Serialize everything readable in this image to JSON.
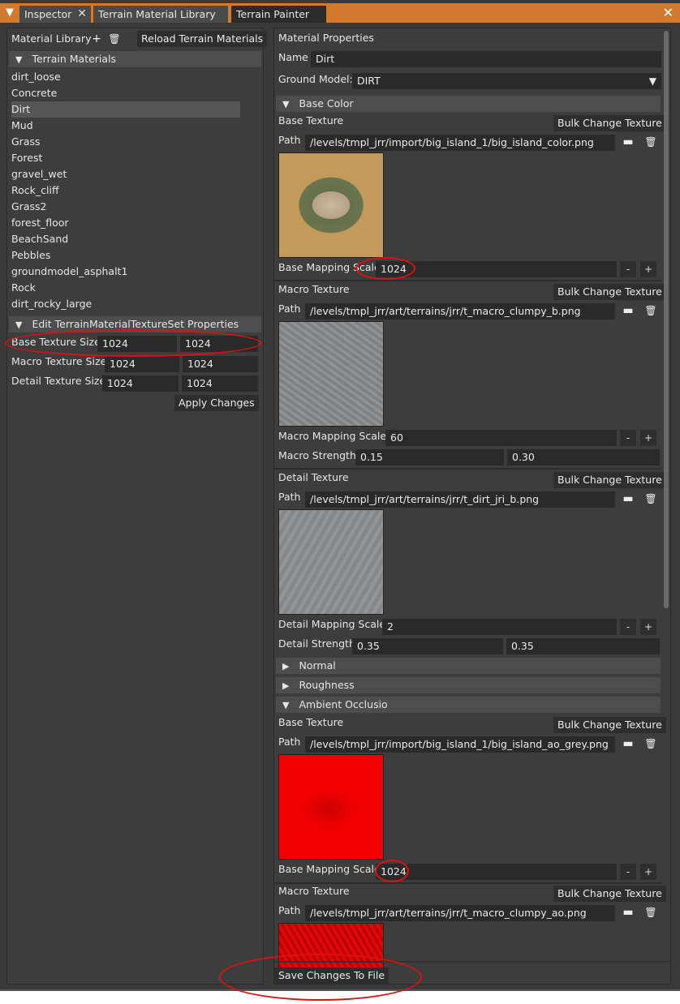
{
  "tabs": {
    "inspector": "Inspector",
    "terrain_material_library": "Terrain Material Library",
    "terrain_painter": "Terrain Painter"
  },
  "left": {
    "material_library_label": "Material Library",
    "reload_button": "Reload Terrain Materials",
    "terrain_materials_header": "Terrain Materials",
    "materials": [
      "dirt_loose",
      "Concrete",
      "Dirt",
      "Mud",
      "Grass",
      "Forest",
      "gravel_wet",
      "Rock_cliff",
      "Grass2",
      "forest_floor",
      "BeachSand",
      "Pebbles",
      "groundmodel_asphalt1",
      "Rock",
      "dirt_rocky_large"
    ],
    "selected_material": "Dirt",
    "edit_header": "Edit TerrainMaterialTextureSet Properties",
    "base_texture_size_label": "Base Texture Size",
    "base_texture_size": [
      "1024",
      "1024"
    ],
    "macro_texture_size_label": "Macro Texture Size",
    "macro_texture_size": [
      "1024",
      "1024"
    ],
    "detail_texture_size_label": "Detail Texture Size",
    "detail_texture_size": [
      "1024",
      "1024"
    ],
    "apply_button": "Apply Changes"
  },
  "right": {
    "title": "Material Properties",
    "name_label": "Name",
    "name_value": "Dirt",
    "ground_model_label": "Ground Model:",
    "ground_model_value": "DIRT",
    "base_color_header": "Base Color",
    "base_texture_label": "Base Texture",
    "bulk_change": "Bulk Change Texture",
    "path_label": "Path",
    "base_color_path": "/levels/tmpl_jrr/import/big_island_1/big_island_color.png",
    "base_mapping_scale_label": "Base Mapping Scale",
    "base_mapping_scale": "1024",
    "macro_texture_label": "Macro Texture",
    "macro_path": "/levels/tmpl_jrr/art/terrains/jrr/t_macro_clumpy_b.png",
    "macro_mapping_scale_label": "Macro Mapping Scale",
    "macro_mapping_scale": "60",
    "macro_strength_label": "Macro Strength",
    "macro_strength": [
      "0.15",
      "0.30"
    ],
    "detail_texture_label": "Detail Texture",
    "detail_path": "/levels/tmpl_jrr/art/terrains/jrr/t_dirt_jri_b.png",
    "detail_mapping_scale_label": "Detail Mapping Scale",
    "detail_mapping_scale": "2",
    "detail_strength_label": "Detail Strength",
    "detail_strength": [
      "0.35",
      "0.35"
    ],
    "normal_header": "Normal",
    "roughness_header": "Roughness",
    "ao_header": "Ambient Occlusio",
    "ao_base_path": "/levels/tmpl_jrr/import/big_island_1/big_island_ao_grey.png",
    "ao_base_mapping_scale": "1024",
    "ao_macro_path": "/levels/tmpl_jrr/art/terrains/jrr/t_macro_clumpy_ao.png",
    "minus": "-",
    "plus": "+"
  },
  "save_button": "Save Changes To File"
}
